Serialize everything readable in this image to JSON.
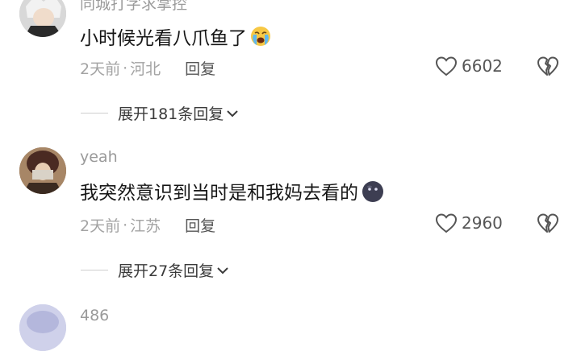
{
  "comments": [
    {
      "username": "同城打字求掌控",
      "text": "小时候光看八爪鱼了",
      "emoji": "loudly-crying-face-emoji",
      "time": "2天前",
      "location": "河北",
      "reply": "回复",
      "likes": "6602",
      "expand": "展开181条回复"
    },
    {
      "username": "yeah",
      "text": "我突然意识到当时是和我妈去看的",
      "emoji": "dark-face-emoji",
      "time": "2天前",
      "location": "江苏",
      "reply": "回复",
      "likes": "2960",
      "expand": "展开27条回复"
    },
    {
      "username": "486"
    }
  ],
  "meta_separator": "·",
  "icons": {
    "like": "heart-outline-icon",
    "dislike": "broken-heart-icon",
    "expand": "chevron-down-icon"
  },
  "colors": {
    "username": "#9a9a9a",
    "text": "#161616",
    "meta": "#a3a3a3"
  }
}
